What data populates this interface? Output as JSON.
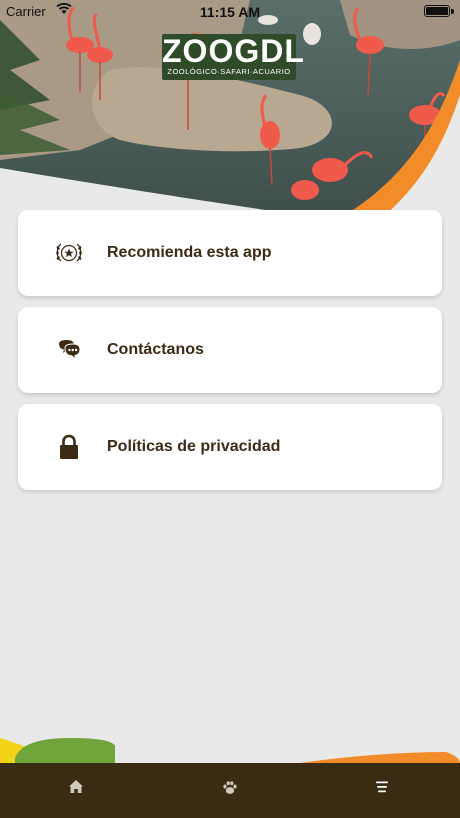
{
  "status_bar": {
    "carrier": "Carrier",
    "time": "11:15 AM"
  },
  "header": {
    "logo_word": "ZOOGDL",
    "logo_sub": "ZOOLÓGICO·SAFARI·ACUARIO"
  },
  "menu": {
    "items": [
      {
        "label": "Recomienda esta app",
        "icon": "award-star-icon"
      },
      {
        "label": "Contáctanos",
        "icon": "chat-bubbles-icon"
      },
      {
        "label": "Políticas de privacidad",
        "icon": "lock-icon"
      }
    ]
  },
  "tabbar": {
    "items": [
      {
        "icon": "home-icon"
      },
      {
        "icon": "paw-icon"
      },
      {
        "icon": "menu-icon"
      }
    ]
  },
  "colors": {
    "background": "#e9e9e9",
    "card": "#ffffff",
    "text_dark_brown": "#3c2a14",
    "tabbar": "#3a2c12",
    "accent_orange": "#f28c28",
    "accent_yellow": "#f3d31a",
    "accent_green": "#6fa53a",
    "logo_green": "#2f4b2a"
  }
}
